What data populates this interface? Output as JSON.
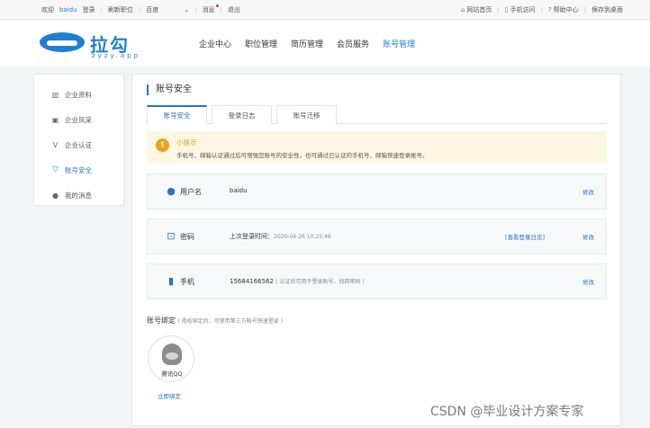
{
  "topbar": {
    "welcome": "欢迎",
    "user": "baidu",
    "login": "登录",
    "refresh": "刷新职位",
    "select_value": "百度",
    "select_arrow": "⌄",
    "messages": "消息",
    "logout": "退出",
    "site_home": "网站首页",
    "mobile": "手机访问",
    "help": "帮助中心",
    "save_desktop": "保存到桌面"
  },
  "logo": {
    "brand": "拉勾",
    "domain": "zyzy.app"
  },
  "nav": {
    "items": [
      "企业中心",
      "职位管理",
      "简历管理",
      "会员服务",
      "账号管理"
    ],
    "active_index": 4
  },
  "sidebar": {
    "items": [
      {
        "label": "企业资料",
        "icon": "building-icon"
      },
      {
        "label": "企业风采",
        "icon": "image-icon"
      },
      {
        "label": "企业认证",
        "icon": "verify-icon"
      },
      {
        "label": "账号安全",
        "icon": "shield-icon"
      },
      {
        "label": "我的消息",
        "icon": "chat-icon"
      }
    ],
    "active_index": 3
  },
  "main": {
    "title": "账号安全",
    "tabs": [
      "账号安全",
      "登录日志",
      "账号迁移"
    ],
    "active_tab": 0,
    "tip": {
      "title": "小提示",
      "text": "手机号、邮箱认证通过后可增强您账号的安全性，也可通过已认证的手机号、邮箱快速登录帐号。"
    },
    "rows": {
      "username": {
        "label": "用户名",
        "value": "baidu",
        "edit": "修改"
      },
      "password": {
        "label": "密码",
        "value": "上次登录时间：",
        "time": "2020-04-26 10:25:49",
        "link": "[查看登录日志]",
        "edit": "修改"
      },
      "phone": {
        "label": "手机",
        "value": "15684166562",
        "note": "( 认证后可用于登录账号、找回密码 )",
        "edit": "修改"
      }
    },
    "binding": {
      "title": "账号绑定",
      "hint": "( 授权绑定后，可使用第三方帐号快速登录 )",
      "qq_label": "腾讯QQ",
      "bind_link": "立即绑定"
    }
  },
  "watermark": "CSDN @毕业设计方案专家",
  "colors": {
    "accent": "#2e6fc7",
    "brand": "#1f7fd1",
    "tip_bg": "#fdf6e3",
    "tip_icon": "#f0a018"
  }
}
